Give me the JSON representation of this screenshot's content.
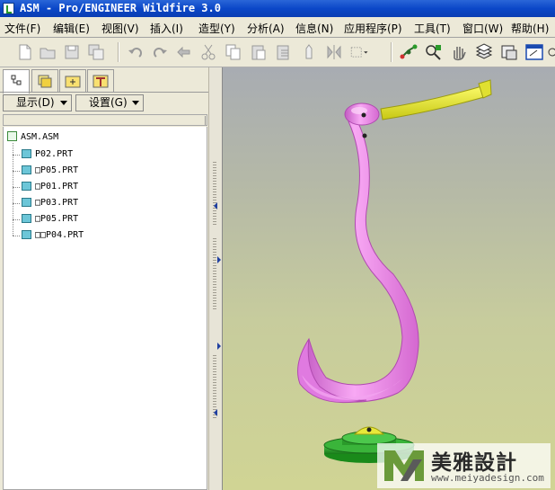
{
  "window": {
    "title": "ASM - Pro/ENGINEER Wildfire 3.0"
  },
  "menu": [
    {
      "label": "文件(F)"
    },
    {
      "label": "编辑(E)"
    },
    {
      "label": "视图(V)"
    },
    {
      "label": "插入(I)"
    },
    {
      "label": "造型(Y)"
    },
    {
      "label": "分析(A)"
    },
    {
      "label": "信息(N)"
    },
    {
      "label": "应用程序(P)"
    },
    {
      "label": "工具(T)"
    },
    {
      "label": "窗口(W)"
    },
    {
      "label": "帮助(H)"
    }
  ],
  "toolbar": {
    "buttons": [
      "new-file-icon",
      "open-file-icon",
      "save-icon",
      "save-copy-icon",
      "undo-icon",
      "redo-icon",
      "regenerate-icon",
      "cut-icon",
      "copy-icon",
      "paste-icon",
      "paste-special-icon",
      "tag-icon",
      "mirror-icon",
      "select-box-icon",
      "datum-axis-icon",
      "model-tree-icon",
      "pan-hand-icon",
      "layers-icon",
      "view-manager-icon",
      "graphics-window-icon"
    ]
  },
  "navigator": {
    "tabs": [
      "model-tree-tab",
      "layer-tab",
      "folder-tab",
      "favorites-tab"
    ],
    "display_button": "显示(D)",
    "settings_button": "设置(G)"
  },
  "tree": {
    "root": "ASM.ASM",
    "items": [
      {
        "label": "P02.PRT"
      },
      {
        "label": "□P05.PRT"
      },
      {
        "label": "□P01.PRT"
      },
      {
        "label": "□P03.PRT"
      },
      {
        "label": "□P05.PRT"
      },
      {
        "label": "□□P04.PRT"
      }
    ]
  },
  "watermark": {
    "text": "美雅設計",
    "url": "www.meiyadesign.com"
  },
  "colors": {
    "titlebar": "#0b47c8",
    "model_body": "#f08aec",
    "handle": "#e6e61e",
    "base_ring": "#2a9a2a"
  }
}
